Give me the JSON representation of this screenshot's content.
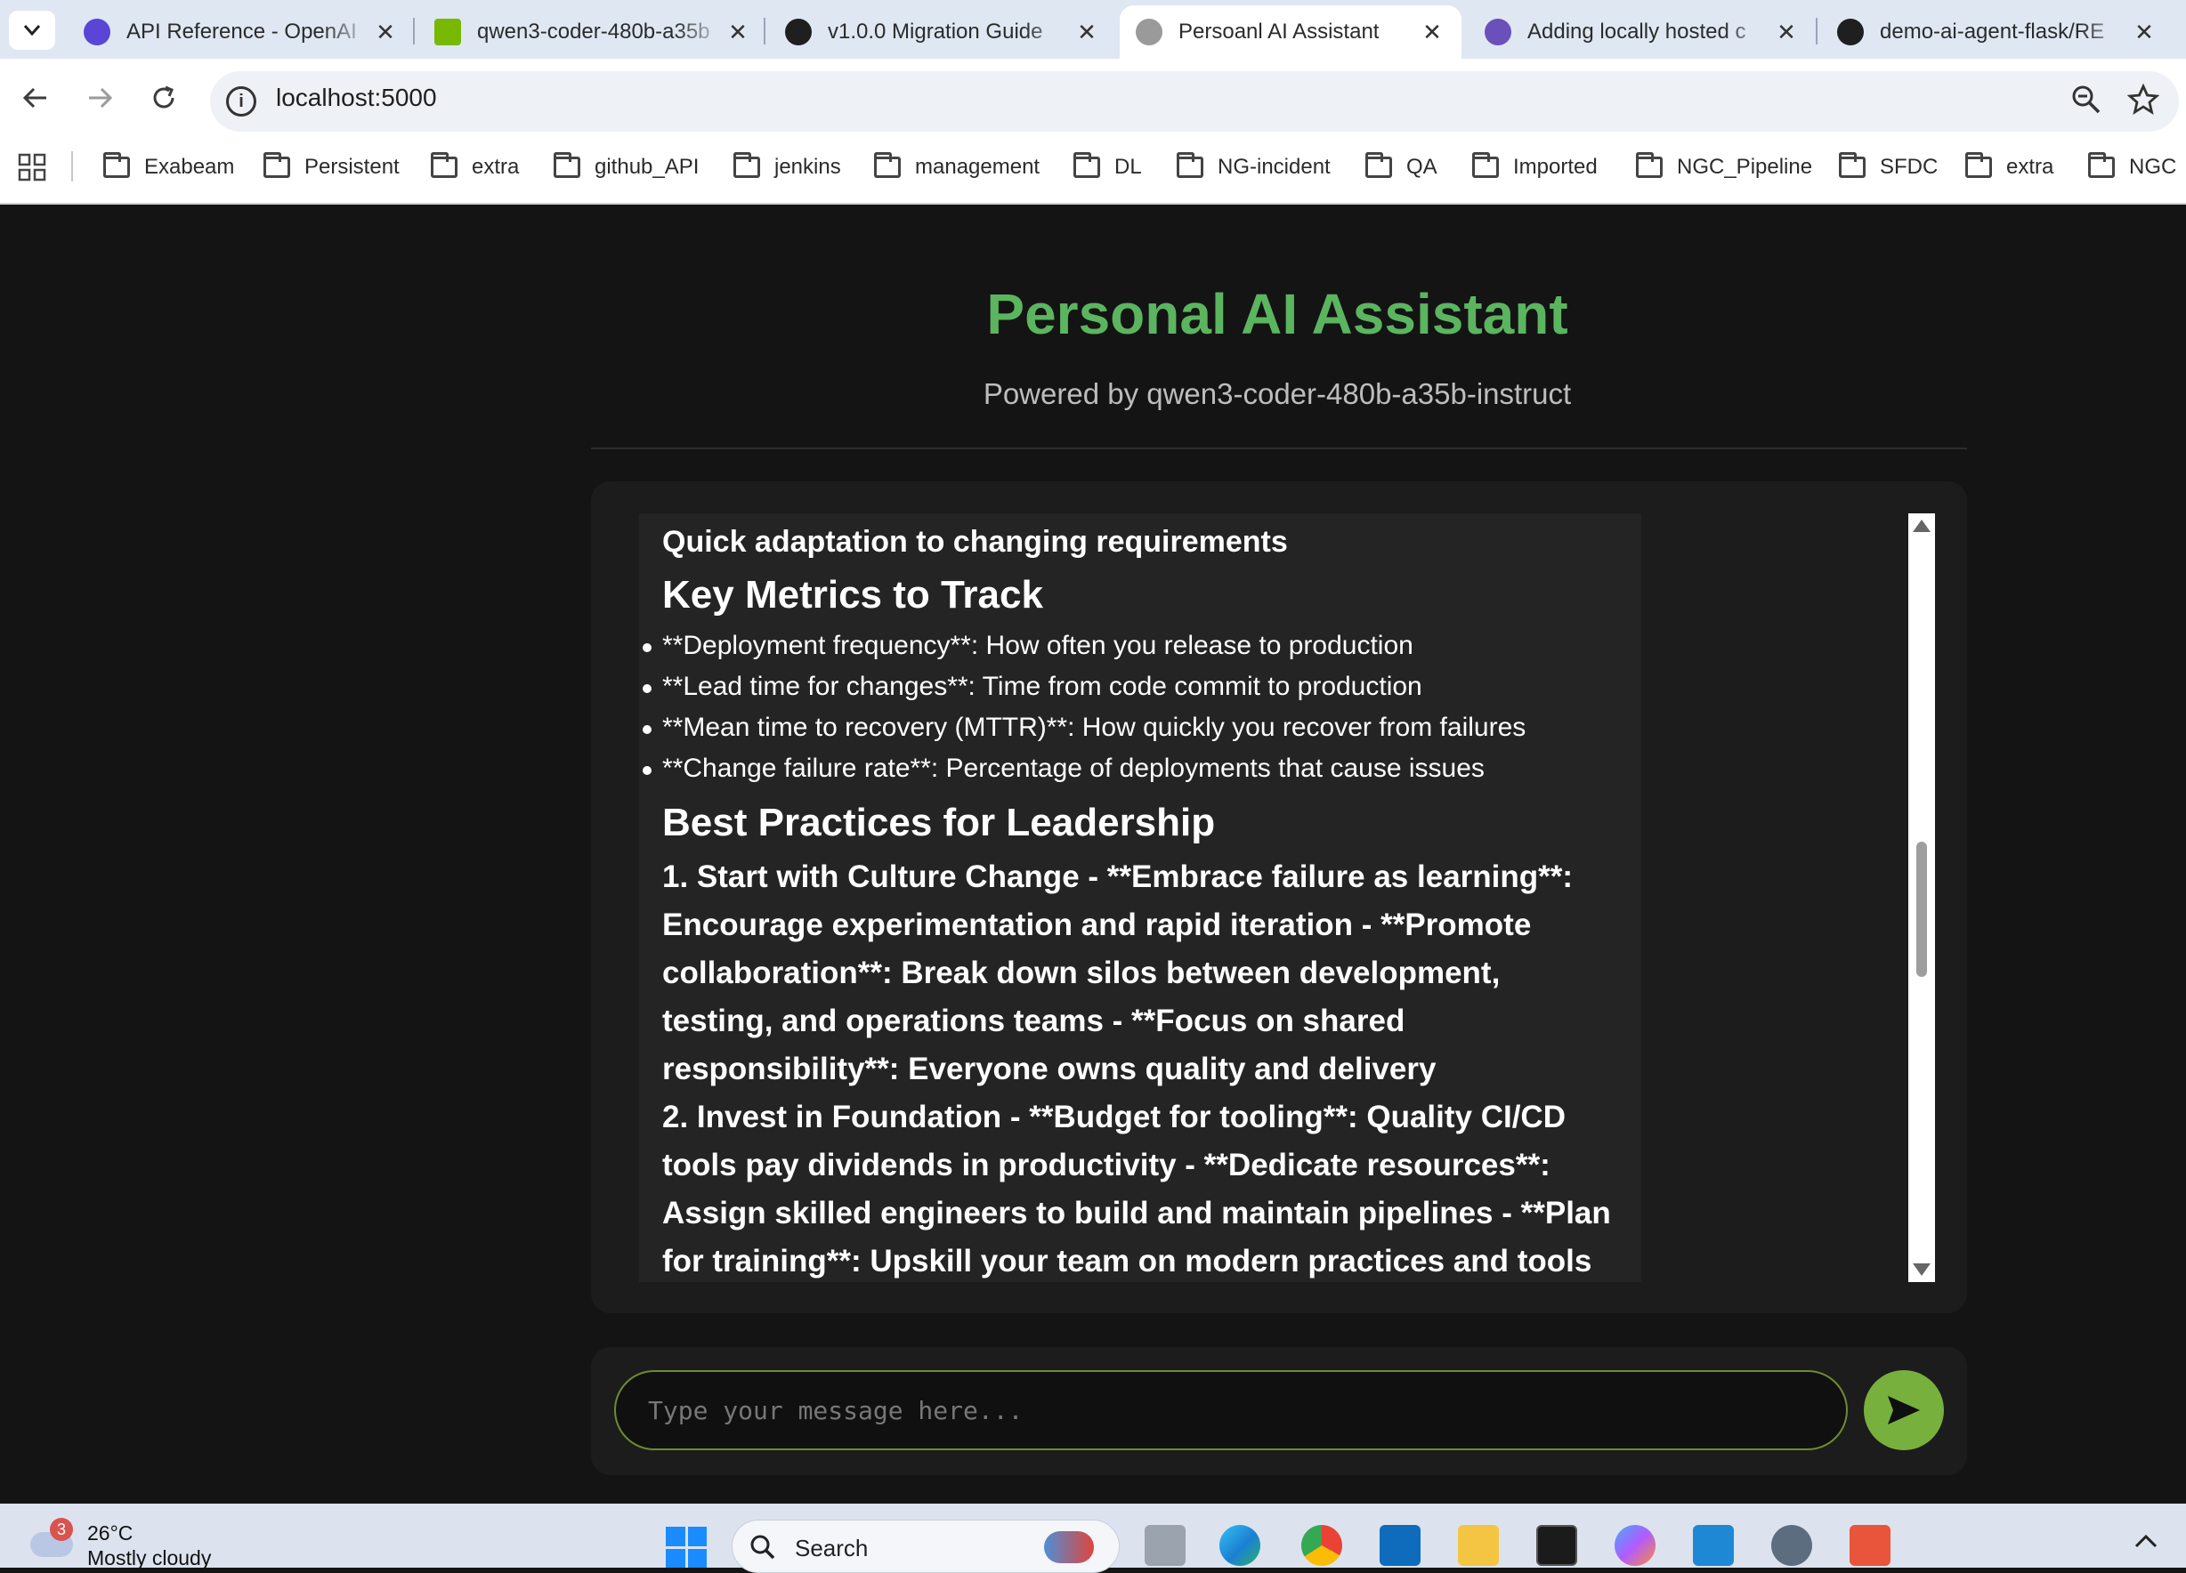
{
  "browser": {
    "tabs": [
      {
        "title": "API Reference - OpenAI",
        "active": false
      },
      {
        "title": "qwen3-coder-480b-a35b",
        "active": false
      },
      {
        "title": "v1.0.0 Migration Guide",
        "active": false
      },
      {
        "title": "Persoanl AI Assistant",
        "active": true
      },
      {
        "title": "Adding locally hosted c",
        "active": false
      },
      {
        "title": "demo-ai-agent-flask/RE",
        "active": false
      }
    ],
    "url": "localhost:5000",
    "bookmarks": [
      "Exabeam",
      "Persistent",
      "extra",
      "github_API",
      "jenkins",
      "management",
      "DL",
      "NG-incident",
      "QA",
      "Imported",
      "NGC_Pipeline",
      "SFDC",
      "extra",
      "NGC"
    ]
  },
  "page": {
    "title": "Personal AI Assistant",
    "subtitle": "Powered by qwen3-coder-480b-a35b-instruct"
  },
  "message": {
    "line_top": "Quick adaptation to changing requirements",
    "heading_metrics": "Key Metrics to Track",
    "metrics": [
      "**Deployment frequency**: How often you release to production",
      "**Lead time for changes**: Time from code commit to production",
      "**Mean time to recovery (MTTR)**: How quickly you recover from failures",
      "**Change failure rate**: Percentage of deployments that cause issues"
    ],
    "heading_practices": "Best Practices for Leadership",
    "practice_1": "1. Start with Culture Change - **Embrace failure as learning**: Encourage experimentation and rapid iteration - **Promote collaboration**: Break down silos between development, testing, and operations teams - **Focus on shared responsibility**: Everyone owns quality and delivery",
    "practice_2": "2. Invest in Foundation - **Budget for tooling**: Quality CI/CD tools pay dividends in productivity - **Dedicate resources**: Assign skilled engineers to build and maintain pipelines - **Plan for training**: Upskill your team on modern practices and tools"
  },
  "chat_input": {
    "placeholder": "Type your message here..."
  },
  "taskbar": {
    "weather_temp": "26°C",
    "weather_desc": "Mostly cloudy",
    "weather_badge": "3",
    "search_label": "Search"
  },
  "colors": {
    "title_green": "#5bb55f",
    "send_button": "#77b03d",
    "background": "#141414"
  }
}
